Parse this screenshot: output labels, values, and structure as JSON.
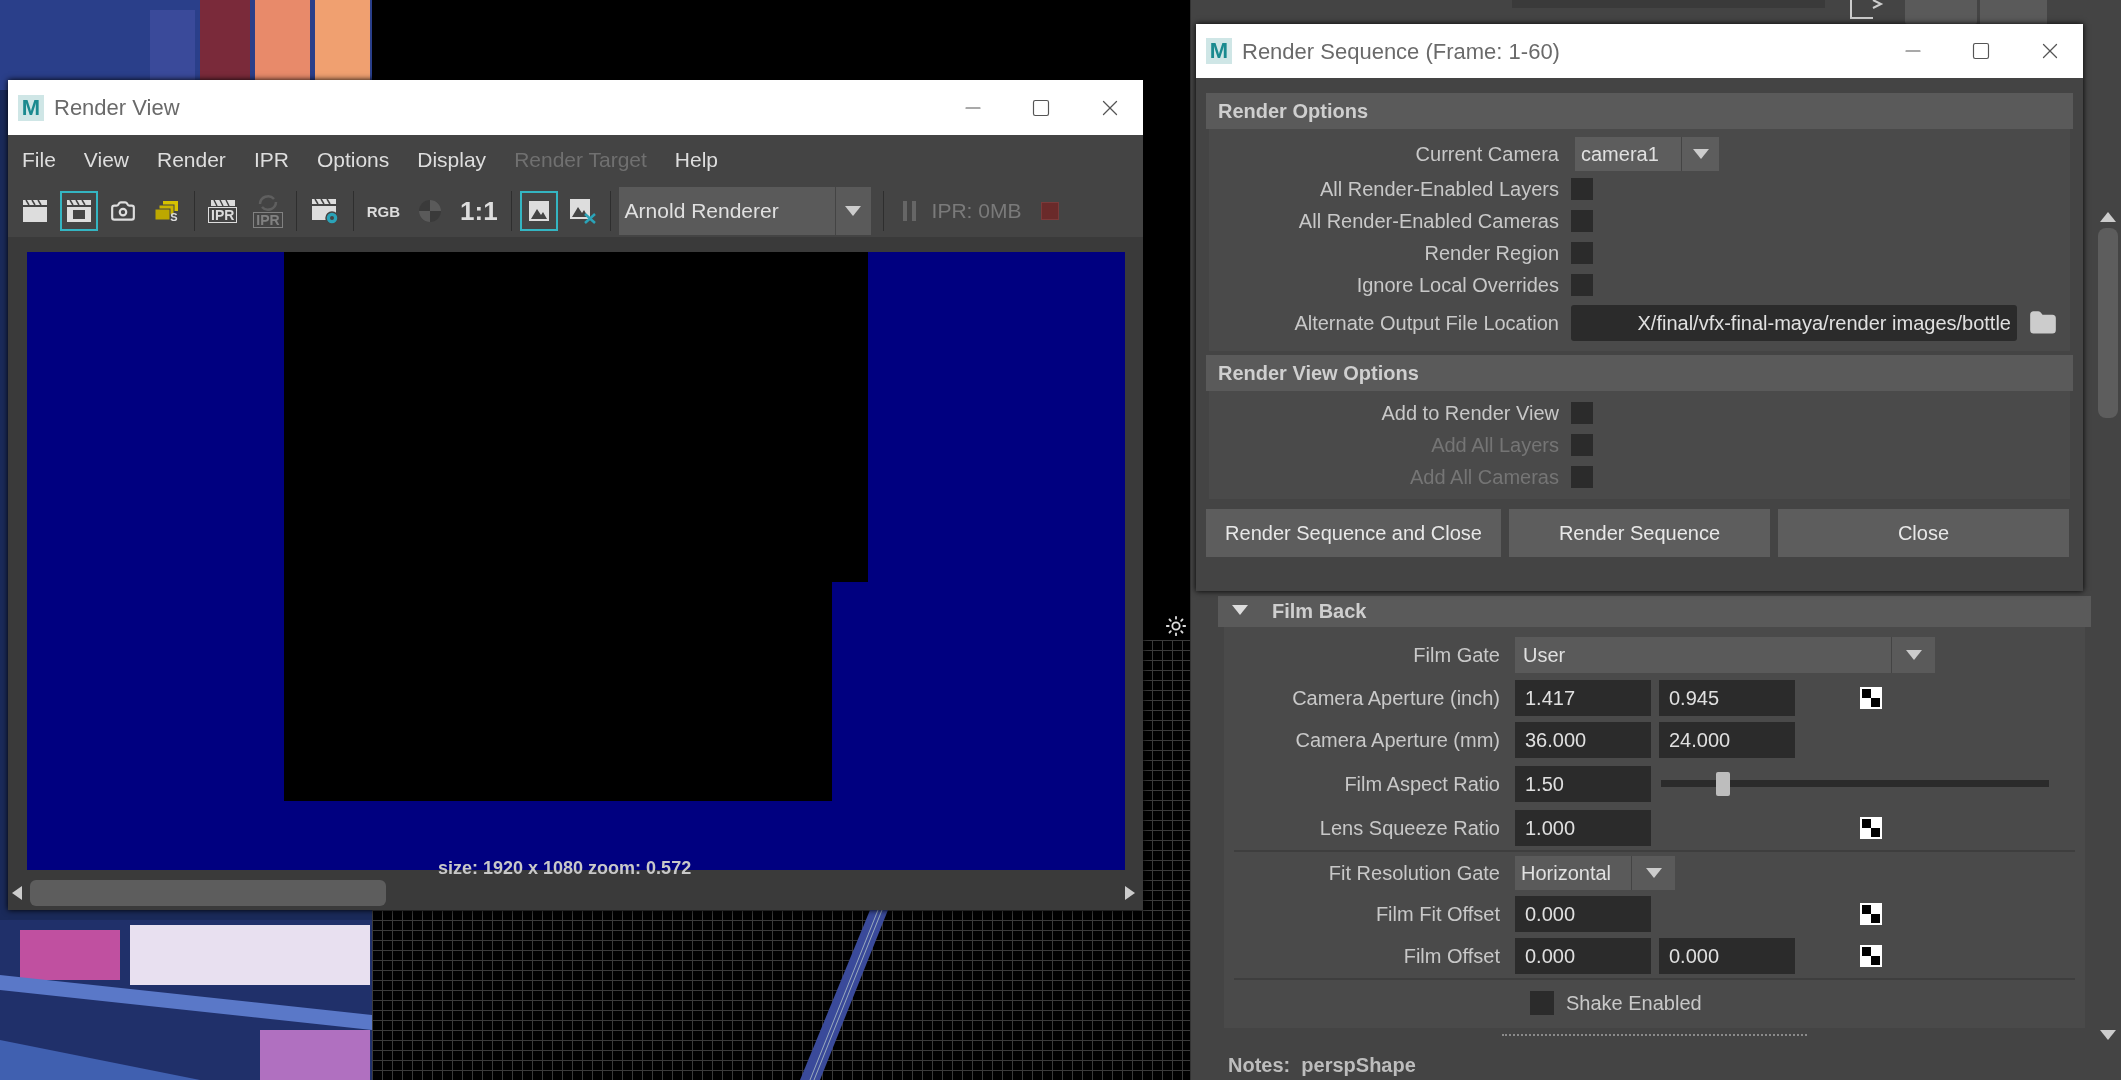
{
  "render_view": {
    "logo": "M",
    "title": "Render View",
    "menu": [
      {
        "label": "File",
        "disabled": false
      },
      {
        "label": "View",
        "disabled": false
      },
      {
        "label": "Render",
        "disabled": false
      },
      {
        "label": "IPR",
        "disabled": false
      },
      {
        "label": "Options",
        "disabled": false
      },
      {
        "label": "Display",
        "disabled": false
      },
      {
        "label": "Render Target",
        "disabled": true
      },
      {
        "label": "Help",
        "disabled": false
      }
    ],
    "toolbar": [
      {
        "selected": false,
        "disabled": false
      },
      {
        "selected": true,
        "disabled": false
      },
      {
        "selected": false,
        "disabled": false
      },
      {
        "label": "S",
        "selected": false,
        "disabled": false
      },
      {
        "label": "IPR",
        "selected": false,
        "disabled": false
      },
      {
        "label": "IPR",
        "selected": false,
        "disabled": true
      },
      {
        "selected": false,
        "disabled": false
      },
      {
        "label": "RGB",
        "selected": false,
        "disabled": false
      },
      {
        "selected": false,
        "disabled": false
      },
      {
        "label": "1:1",
        "selected": false,
        "disabled": false
      },
      {
        "selected": true,
        "disabled": false
      },
      {
        "selected": false,
        "disabled": false
      }
    ],
    "renderer": "Arnold Renderer",
    "ipr_memory": "IPR: 0MB",
    "status": "size: 1920 x 1080 zoom: 0.572"
  },
  "render_sequence": {
    "logo": "M",
    "title": "Render Sequence (Frame: 1-60)",
    "sections": [
      {
        "title": "Render Options",
        "rows": [
          {
            "kind": "dropdown",
            "label": "Current Camera",
            "value": "camera1",
            "disabled": false
          },
          {
            "kind": "checkbox",
            "label": "All Render-Enabled Layers",
            "checked": false,
            "disabled": false
          },
          {
            "kind": "checkbox",
            "label": "All Render-Enabled Cameras",
            "checked": false,
            "disabled": false
          },
          {
            "kind": "checkbox",
            "label": "Render Region",
            "checked": false,
            "disabled": false
          },
          {
            "kind": "checkbox",
            "label": "Ignore Local Overrides",
            "checked": false,
            "disabled": false
          },
          {
            "kind": "path",
            "label": "Alternate Output File Location",
            "value": "X/final/vfx-final-maya/render images/bottle",
            "disabled": false
          }
        ]
      },
      {
        "title": "Render View Options",
        "rows": [
          {
            "kind": "checkbox",
            "label": "Add to Render View",
            "checked": false,
            "disabled": false
          },
          {
            "kind": "checkbox",
            "label": "Add All Layers",
            "checked": false,
            "disabled": true
          },
          {
            "kind": "checkbox",
            "label": "Add All Cameras",
            "checked": false,
            "disabled": true
          }
        ]
      }
    ],
    "buttons": [
      "Render Sequence and Close",
      "Render Sequence",
      "Close"
    ]
  },
  "attribute_editor": {
    "section": {
      "title": "Film Back",
      "expanded": true,
      "rows": [
        {
          "kind": "dropdown",
          "label": "Film Gate",
          "value": "User"
        },
        {
          "kind": "pair",
          "label": "Camera Aperture (inch)",
          "values": [
            "1.417",
            "0.945"
          ],
          "map": true
        },
        {
          "kind": "pair",
          "label": "Camera Aperture (mm)",
          "values": [
            "36.000",
            "24.000"
          ],
          "map": false
        },
        {
          "kind": "slider",
          "label": "Film Aspect Ratio",
          "values": [
            "1.50"
          ],
          "level": 0.16
        },
        {
          "kind": "field",
          "label": "Lens Squeeze Ratio",
          "values": [
            "1.000"
          ],
          "map": true
        },
        {
          "kind": "divider"
        },
        {
          "kind": "option_menu",
          "label": "Fit Resolution Gate",
          "value": "Horizontal"
        },
        {
          "kind": "field",
          "label": "Film Fit Offset",
          "values": [
            "0.000"
          ],
          "map": true
        },
        {
          "kind": "pair",
          "label": "Film Offset",
          "values": [
            "0.000",
            "0.000"
          ],
          "map": true
        },
        {
          "kind": "divider"
        },
        {
          "kind": "checkbox",
          "label": "Shake Enabled",
          "checked": false
        }
      ]
    },
    "notes": "Notes:  perspShape"
  }
}
